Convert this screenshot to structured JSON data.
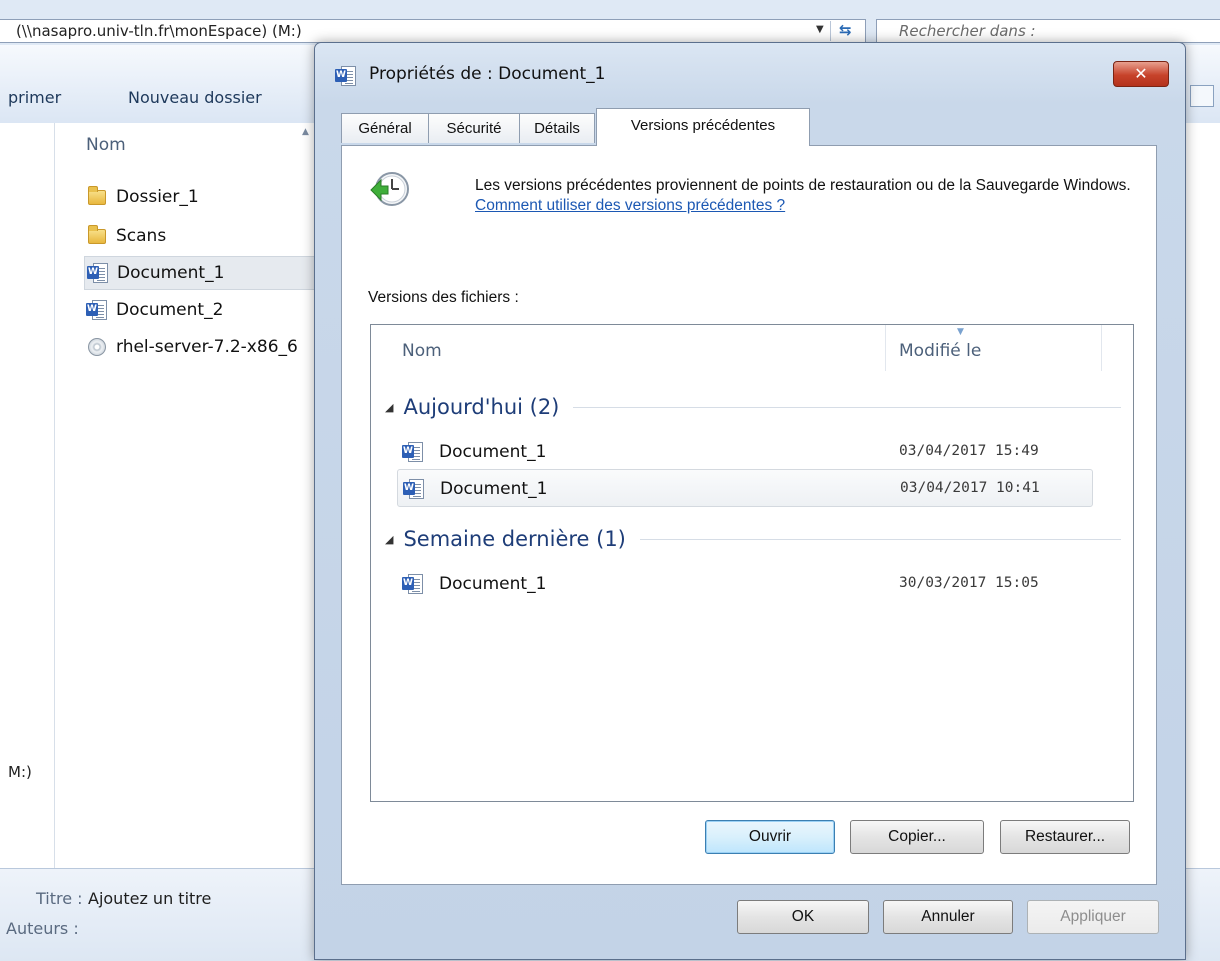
{
  "explorer": {
    "address": "(\\\\nasapro.univ-tln.fr\\monEspace) (M:)",
    "search_placeholder": "Rechercher dans :",
    "toolbar": {
      "print_label": "primer",
      "new_folder_label": "Nouveau dossier"
    },
    "nav_drive_label": "M:)",
    "column_name": "Nom",
    "files": [
      {
        "name": "Dossier_1",
        "icon": "folder-icon"
      },
      {
        "name": "Scans",
        "icon": "folder-icon"
      },
      {
        "name": "Document_1",
        "icon": "word-document-icon",
        "selected": true
      },
      {
        "name": "Document_2",
        "icon": "word-document-icon"
      },
      {
        "name": "rhel-server-7.2-x86_6",
        "icon": "disc-image-icon"
      }
    ],
    "details": {
      "title_label": "Titre :",
      "title_value": "Ajoutez un titre",
      "authors_label": "Auteurs :"
    }
  },
  "dialog": {
    "title": "Propriétés de : Document_1",
    "close_glyph": "✕",
    "tabs": [
      {
        "label": "Général"
      },
      {
        "label": "Sécurité"
      },
      {
        "label": "Détails"
      },
      {
        "label": "Versions précédentes",
        "active": true
      }
    ],
    "info_text": "Les versions précédentes proviennent de points de restauration ou de la Sauvegarde Windows.",
    "info_link": "Comment utiliser des versions précédentes ?",
    "versions_label": "Versions des fichiers :",
    "list_headers": {
      "name": "Nom",
      "modified": "Modifié le"
    },
    "groups": [
      {
        "label": "Aujourd'hui (2)",
        "items": [
          {
            "name": "Document_1",
            "date": "03/04/2017 15:49"
          },
          {
            "name": "Document_1",
            "date": "03/04/2017 10:41",
            "selected": true
          }
        ]
      },
      {
        "label": "Semaine dernière (1)",
        "items": [
          {
            "name": "Document_1",
            "date": "30/03/2017 15:05"
          }
        ]
      }
    ],
    "buttons": {
      "open": "Ouvrir",
      "copy": "Copier...",
      "restore": "Restaurer...",
      "ok": "OK",
      "cancel": "Annuler",
      "apply": "Appliquer"
    }
  },
  "colors": {
    "title_bar": "#c9d8ea",
    "close_button": "#c7432b",
    "link": "#1c58b3",
    "group_header": "#1e3d78"
  }
}
